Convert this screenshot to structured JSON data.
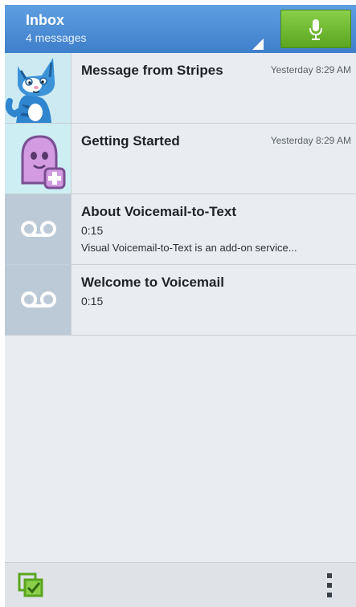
{
  "header": {
    "title": "Inbox",
    "subtitle": "4 messages",
    "mic_icon": "microphone-icon",
    "accent_color": "#4a8bd6",
    "mic_button_color": "#6bbd2e"
  },
  "messages": [
    {
      "title": "Message from Stripes",
      "time": "Yesterday 8:29 AM",
      "duration": "",
      "preview": "",
      "avatar": "cat-avatar"
    },
    {
      "title": "Getting Started",
      "time": "Yesterday 8:29 AM",
      "duration": "",
      "preview": "",
      "avatar": "add-contact-avatar"
    },
    {
      "title": "About Voicemail-to-Text",
      "time": "",
      "duration": "0:15",
      "preview": "Visual Voicemail-to-Text is an add-on service...",
      "avatar": "voicemail-icon"
    },
    {
      "title": "Welcome to Voicemail",
      "time": "",
      "duration": "0:15",
      "preview": "",
      "avatar": "voicemail-icon"
    }
  ],
  "bottom_bar": {
    "select_icon": "select-all-icon",
    "overflow_icon": "more-options-icon"
  }
}
